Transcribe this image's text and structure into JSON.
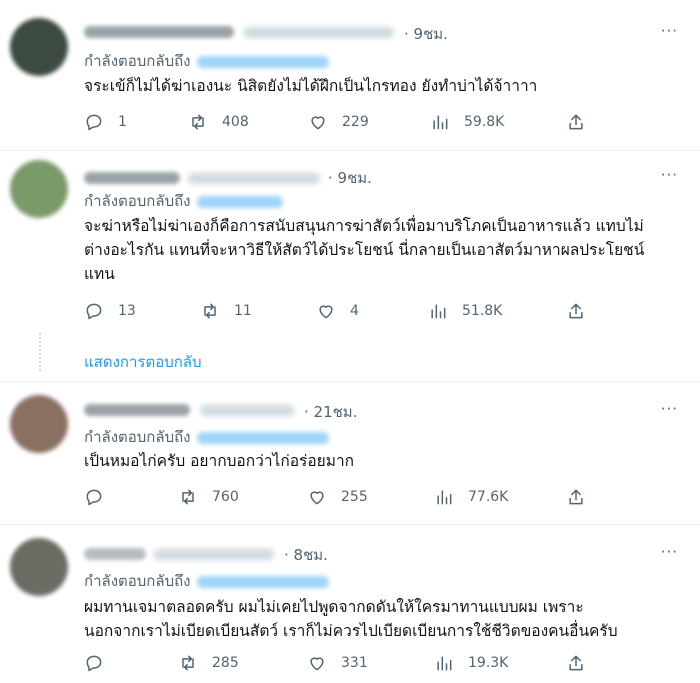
{
  "tweets": [
    {
      "time": "· 9ชม.",
      "reply_prefix": "กำลังตอบกลับถึง",
      "lines": [
        "จระเข้ก็ไม่ได้ฆ่าเองนะ นิสิตยังไม่ได้ฝึกเป็นไกรทอง ยังทำบ่าได้จ้าาาา"
      ],
      "replies": "1",
      "reposts": "408",
      "likes": "229",
      "views": "59.8K",
      "avatar_color": "#3d4a3f"
    },
    {
      "time": "· 9ชม.",
      "reply_prefix": "กำลังตอบกลับถึง",
      "lines": [
        "จะฆ่าหรือไม่ฆ่าเองก็คือการสนับสนุนการฆ่าสัตว์เพื่อมาบริโภคเป็นอาหารแล้ว แทบไม่",
        "ต่างอะไรกัน แทนที่จะหาวิธีให้สัตว์ได้ประโยชน์ นี่กลายเป็นเอาสัตว์มาหาผลประโยชน์",
        "แทน"
      ],
      "replies": "13",
      "reposts": "11",
      "likes": "4",
      "views": "51.8K",
      "avatar_color": "#7a9a6a"
    },
    {
      "time": "· 21ชม.",
      "reply_prefix": "กำลังตอบกลับถึง",
      "lines": [
        "เป็นหมอไก่ครับ อยากบอกว่าไก่อร่อยมาก"
      ],
      "replies": "",
      "reposts": "760",
      "likes": "255",
      "views": "77.6K",
      "avatar_color": "#8a7060"
    },
    {
      "time": "· 8ชม.",
      "reply_prefix": "กำลังตอบกลับถึง",
      "lines": [
        "ผมทานเจมาตลอดครับ ผมไม่เคยไปพูดจากดดันให้ใครมาทานแบบผม เพราะ",
        "นอกจากเราไม่เบียดเบียนสัตว์ เราก็ไม่ควรไปเบียดเบียนการใช้ชีวิตของคนอื่นครับ"
      ],
      "replies": "",
      "reposts": "285",
      "likes": "331",
      "views": "19.3K",
      "avatar_color": "#6b6b63"
    }
  ],
  "show_replies": "แสดงการตอบกลับ",
  "more_glyph": "···"
}
